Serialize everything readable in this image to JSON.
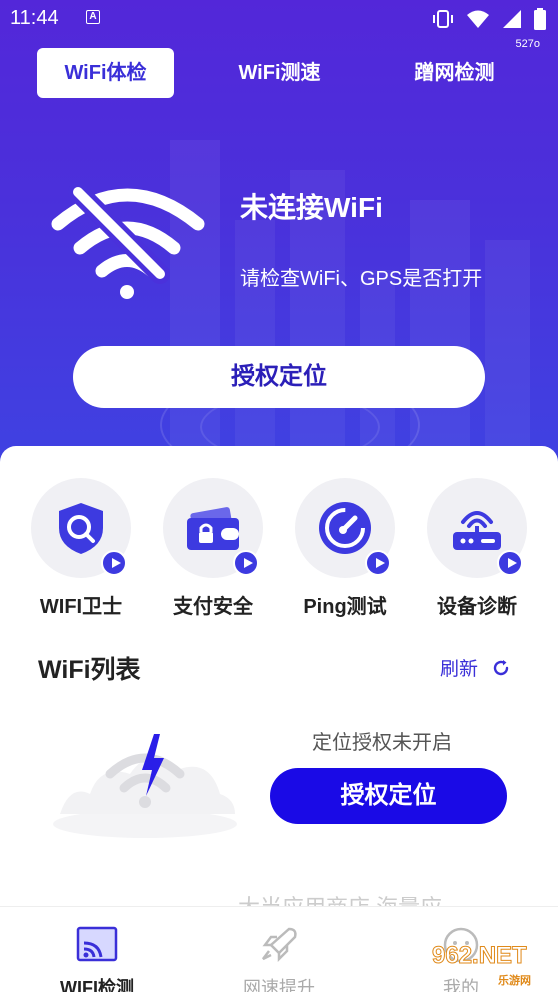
{
  "status_bar": {
    "time": "11:44",
    "badge": "A",
    "net_speed": "527o"
  },
  "tabs": [
    {
      "label": "WiFi体检",
      "active": true
    },
    {
      "label": "WiFi测速",
      "active": false
    },
    {
      "label": "蹭网检测",
      "active": false
    }
  ],
  "hero": {
    "title": "未连接WiFi",
    "subtitle": "请检查WiFi、GPS是否打开",
    "button_label": "授权定位"
  },
  "tools": [
    {
      "label": "WIFI卫士",
      "icon": "shield-search-icon"
    },
    {
      "label": "支付安全",
      "icon": "wallet-lock-icon"
    },
    {
      "label": "Ping测试",
      "icon": "gauge-icon"
    },
    {
      "label": "设备诊断",
      "icon": "router-icon"
    }
  ],
  "wifi_list": {
    "title": "WiFi列表",
    "refresh_label": "刷新",
    "empty_text": "定位授权未开启",
    "empty_button": "授权定位"
  },
  "partial_text": "大当应用商店   海量应",
  "bottom_nav": [
    {
      "label": "WIFI检测",
      "active": true,
      "icon": "cast-wifi-icon"
    },
    {
      "label": "网速提升",
      "active": false,
      "icon": "rocket-icon"
    },
    {
      "label": "我的",
      "active": false,
      "icon": "profile-icon"
    }
  ],
  "watermark": {
    "text": "962.NET",
    "sub": "乐游网"
  },
  "colors": {
    "primary": "#3a2fd8",
    "button_blue": "#1a0ae6",
    "hero_top": "#5327d9"
  }
}
